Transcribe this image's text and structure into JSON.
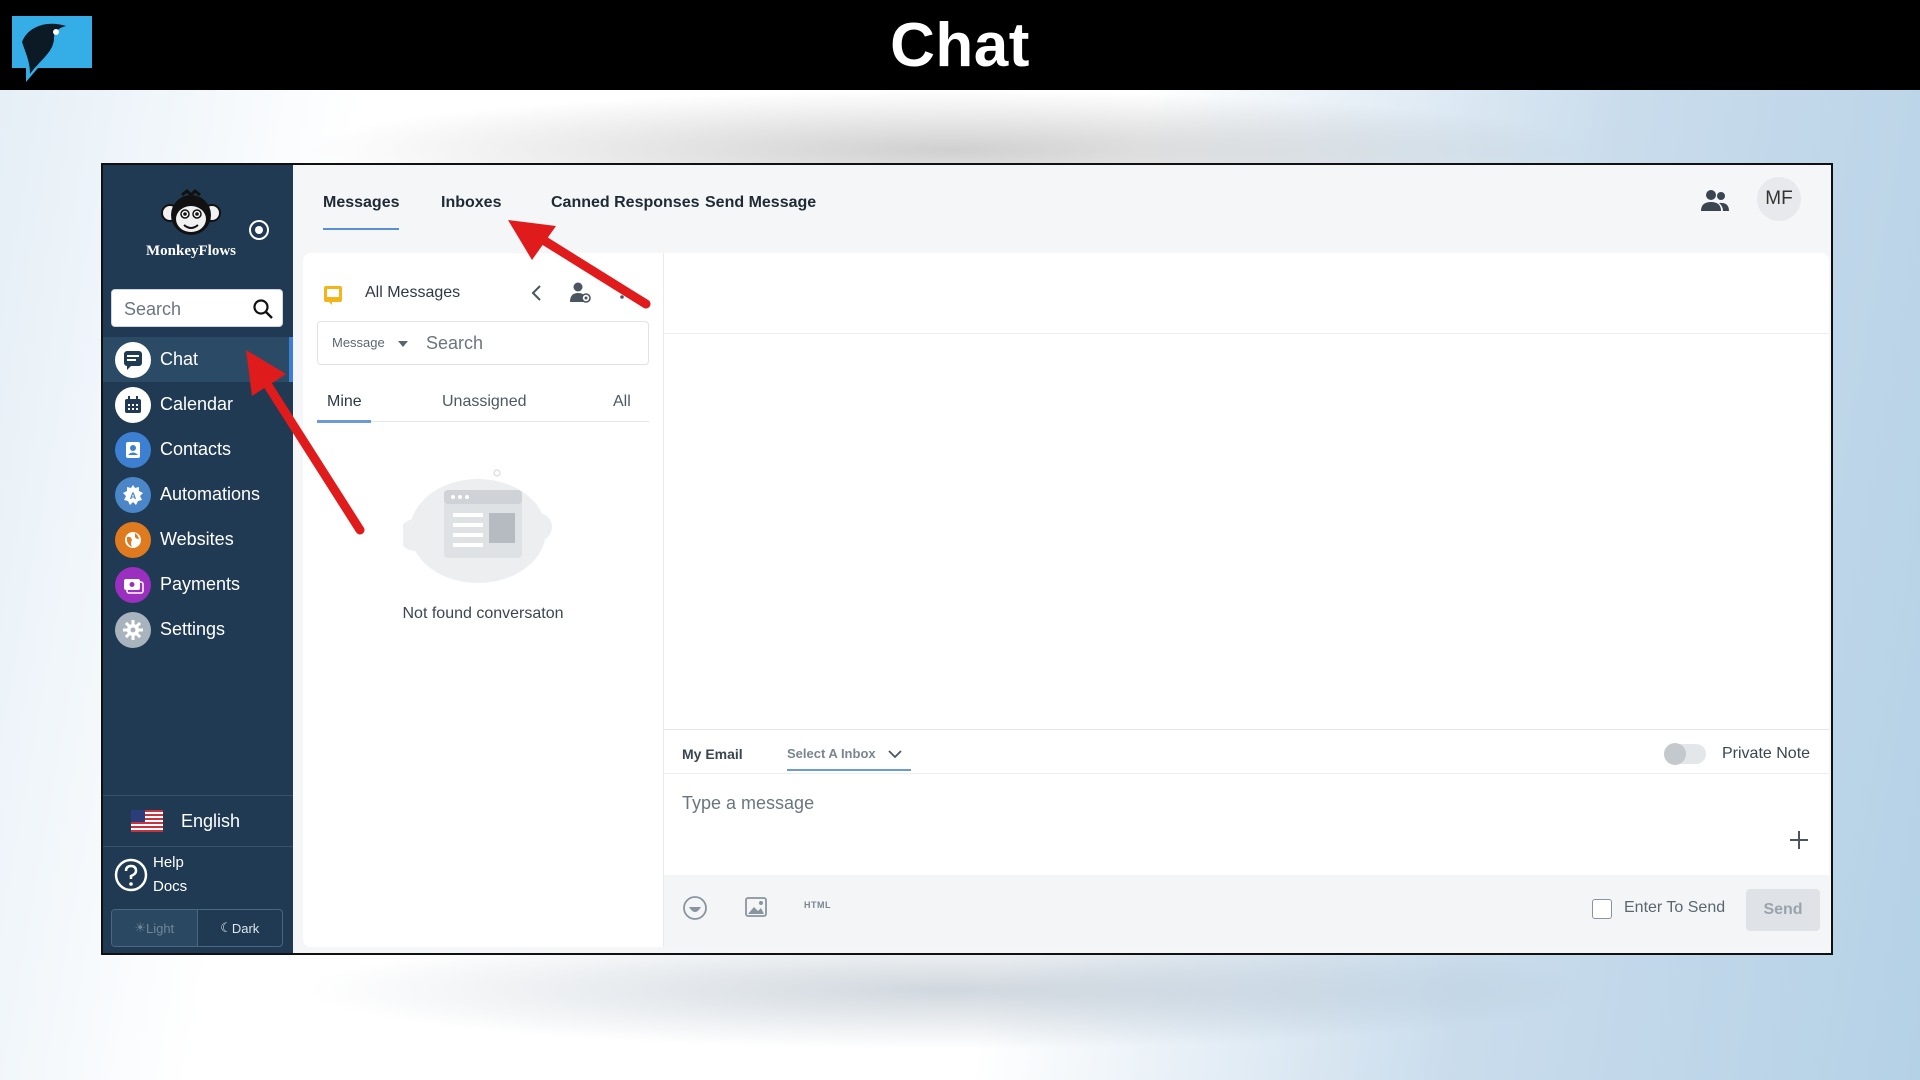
{
  "banner": {
    "title": "Chat"
  },
  "sidebar": {
    "brand_name": "MonkeyFlows",
    "search_placeholder": "Search",
    "items": [
      {
        "label": "Chat",
        "icon": "chat-icon",
        "color": "#ffffff",
        "active": true
      },
      {
        "label": "Calendar",
        "icon": "calendar-icon",
        "color": "#ffffff",
        "active": false
      },
      {
        "label": "Contacts",
        "icon": "contacts-icon",
        "color": "#3d7fd0",
        "active": false
      },
      {
        "label": "Automations",
        "icon": "automations-icon",
        "color": "#4a86c8",
        "active": false
      },
      {
        "label": "Websites",
        "icon": "websites-icon",
        "color": "#e07a1f",
        "active": false
      },
      {
        "label": "Payments",
        "icon": "payments-icon",
        "color": "#9b2fbf",
        "active": false
      },
      {
        "label": "Settings",
        "icon": "settings-icon",
        "color": "#a9b3bd",
        "active": false
      }
    ],
    "language": "English",
    "help_label": "Help Docs",
    "theme_light": "Light",
    "theme_dark": "Dark"
  },
  "header": {
    "tabs": [
      "Messages",
      "Inboxes",
      "Canned Responses",
      "Send Message"
    ],
    "active_tab": "Messages",
    "avatar_initials": "MF"
  },
  "conversations": {
    "filter_title": "All Messages",
    "search_filter": "Message",
    "search_placeholder": "Search",
    "subtabs": [
      "Mine",
      "Unassigned",
      "All"
    ],
    "active_subtab": "Mine",
    "empty_text": "Not found conversaton"
  },
  "composer": {
    "email_tab": "My Email",
    "inbox_select": "Select A Inbox",
    "private_note_label": "Private Note",
    "private_note_on": false,
    "placeholder": "Type a message",
    "html_label": "HTML",
    "enter_to_send_label": "Enter To Send",
    "enter_to_send_checked": false,
    "send_label": "Send"
  },
  "colors": {
    "sidebar_bg": "#1f3a52",
    "accent": "#5a8fd0",
    "annotation_arrow": "#e01b1b"
  }
}
